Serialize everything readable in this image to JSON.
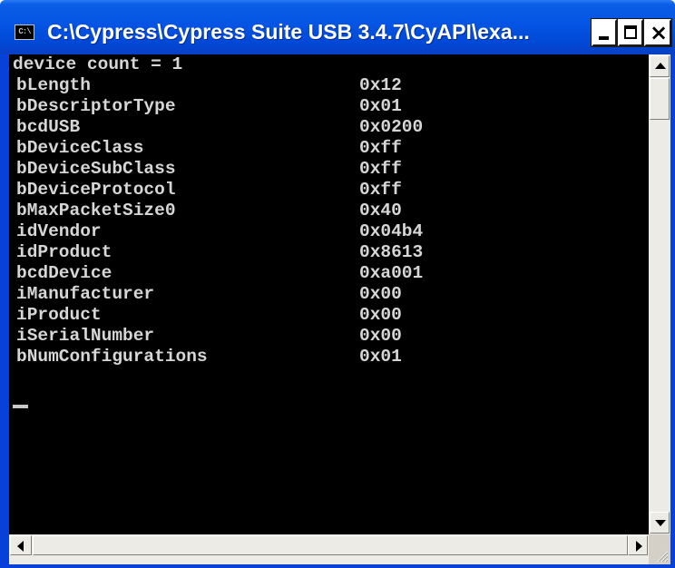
{
  "window": {
    "title": "C:\\Cypress\\Cypress Suite USB 3.4.7\\CyAPI\\exa...",
    "icon_text": "C:\\",
    "icon": "console-icon",
    "buttons": {
      "minimize": "minimize-icon",
      "maximize": "maximize-icon",
      "close": "close-icon",
      "close_glyph": "×"
    }
  },
  "console": {
    "header": "device count = 1",
    "rows": [
      {
        "key": "bLength",
        "value": "0x12"
      },
      {
        "key": "bDescriptorType",
        "value": "0x01"
      },
      {
        "key": "bcdUSB",
        "value": "0x0200"
      },
      {
        "key": "bDeviceClass",
        "value": "0xff"
      },
      {
        "key": "bDeviceSubClass",
        "value": "0xff"
      },
      {
        "key": "bDeviceProtocol",
        "value": "0xff"
      },
      {
        "key": "bMaxPacketSize0",
        "value": "0x40"
      },
      {
        "key": "idVendor",
        "value": "0x04b4"
      },
      {
        "key": "idProduct",
        "value": "0x8613"
      },
      {
        "key": "bcdDevice",
        "value": "0xa001"
      },
      {
        "key": "iManufacturer",
        "value": "0x00"
      },
      {
        "key": "iProduct",
        "value": "0x00"
      },
      {
        "key": "iSerialNumber",
        "value": "0x00"
      },
      {
        "key": "bNumConfigurations",
        "value": "0x01"
      }
    ],
    "text_color": "#c0c0c0",
    "background_color": "#000000"
  },
  "scrollbars": {
    "vertical": {
      "up_icon": "up-arrow-icon",
      "down_icon": "down-arrow-icon"
    },
    "horizontal": {
      "left_icon": "left-arrow-icon",
      "right_icon": "right-arrow-icon"
    }
  },
  "colors": {
    "titlebar": "#0554e3",
    "frame": "#0841d8",
    "scrollbar": "#ecebe6"
  }
}
